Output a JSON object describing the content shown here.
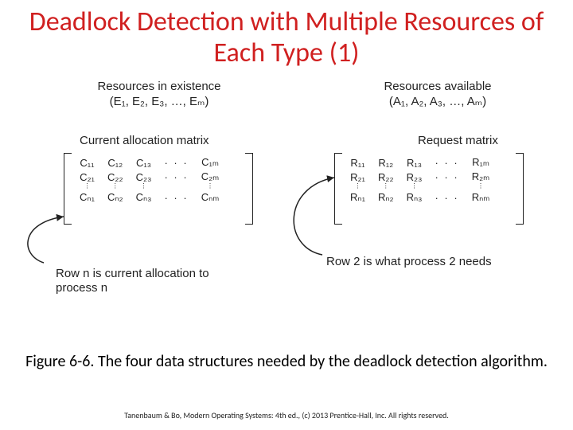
{
  "title": "Deadlock Detection with Multiple Resources of Each Type (1)",
  "left": {
    "existence_label": "Resources in existence",
    "existence_vec": "(E₁, E₂, E₃, …, Eₘ)",
    "matrix_title": "Current allocation matrix",
    "row_note": "Row n is current allocation to process n",
    "matrix": {
      "r0": {
        "c0": "C₁₁",
        "c1": "C₁₂",
        "c2": "C₁₃",
        "c3": "· · ·",
        "c4": "C₁ₘ"
      },
      "r1": {
        "c0": "C₂₁",
        "c1": "C₂₂",
        "c2": "C₂₃",
        "c3": "· · ·",
        "c4": "C₂ₘ"
      },
      "r2": {
        "c0": "⋮",
        "c1": "⋮",
        "c2": "⋮",
        "c3": "",
        "c4": "⋮"
      },
      "r3": {
        "c0": "Cₙ₁",
        "c1": "Cₙ₂",
        "c2": "Cₙ₃",
        "c3": "· · ·",
        "c4": "Cₙₘ"
      }
    }
  },
  "right": {
    "available_label": "Resources available",
    "available_vec": "(A₁, A₂, A₃, …, Aₘ)",
    "matrix_title": "Request matrix",
    "row_note": "Row 2 is what process 2 needs",
    "matrix": {
      "r0": {
        "c0": "R₁₁",
        "c1": "R₁₂",
        "c2": "R₁₃",
        "c3": "· · ·",
        "c4": "R₁ₘ"
      },
      "r1": {
        "c0": "R₂₁",
        "c1": "R₂₂",
        "c2": "R₂₃",
        "c3": "· · ·",
        "c4": "R₂ₘ"
      },
      "r2": {
        "c0": "⋮",
        "c1": "⋮",
        "c2": "⋮",
        "c3": "",
        "c4": "⋮"
      },
      "r3": {
        "c0": "Rₙ₁",
        "c1": "Rₙ₂",
        "c2": "Rₙ₃",
        "c3": "· · ·",
        "c4": "Rₙₘ"
      }
    }
  },
  "caption": "Figure 6-6. The four data structures needed by the deadlock detection algorithm.",
  "footer": "Tanenbaum & Bo, Modern Operating Systems: 4th ed., (c) 2013 Prentice-Hall, Inc. All rights reserved."
}
